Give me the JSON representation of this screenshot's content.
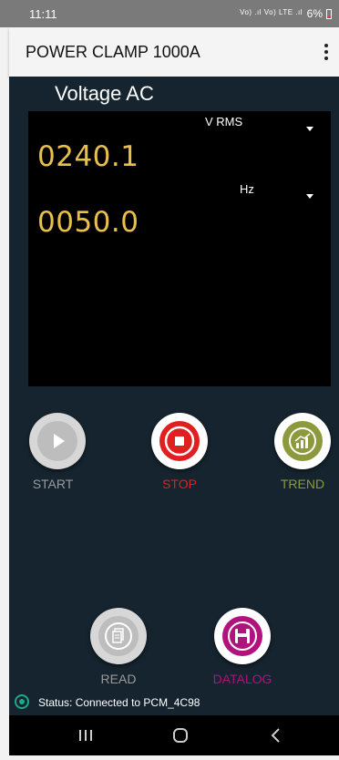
{
  "status_bar": {
    "time": "11:11",
    "signal_text": "Vo) .ıl Vo) LTE .ıl",
    "battery": "6%"
  },
  "app_bar": {
    "title": "POWER CLAMP 1000A"
  },
  "mode_title": "Voltage AC",
  "display": {
    "primary": {
      "unit": "V RMS",
      "value": "0240.1"
    },
    "secondary": {
      "unit": "Hz",
      "value": "0050.0"
    }
  },
  "controls": {
    "start": "START",
    "stop": "STOP",
    "trend": "TREND",
    "read": "READ",
    "datalog": "DATALOG"
  },
  "status": {
    "text": "Status: Connected to PCM_4C98"
  },
  "colors": {
    "background": "#15242e",
    "reading": "#e9c04a",
    "stop": "#e02020",
    "trend": "#8c9a3d",
    "datalog": "#b0127e",
    "disabled": "#9a9a9a"
  },
  "icons": {
    "start": "play-icon",
    "stop": "stop-icon",
    "trend": "chart-icon",
    "read": "document-icon",
    "datalog": "save-icon"
  }
}
